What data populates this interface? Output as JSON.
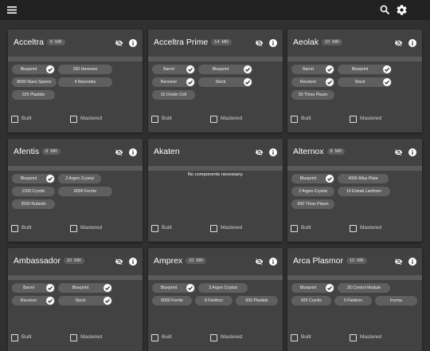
{
  "header": {
    "menu_icon": "hamburger-menu-icon",
    "search_icon": "search-icon",
    "settings_icon": "gear-icon"
  },
  "labels": {
    "built": "Built",
    "mastered": "Mastered"
  },
  "colors": {
    "background": "#303030",
    "card": "#424242",
    "topbar": "#212121",
    "chip": "#5f5f5f"
  },
  "cards": [
    {
      "name": "Acceltra",
      "mr": "6",
      "mr_label": "MR",
      "rows": [
        [
          {
            "label": "Blueprint",
            "done": true
          },
          {
            "label": "250 Hexenon",
            "done": false
          }
        ],
        [
          {
            "label": "8000 Nano Spores",
            "done": false
          },
          {
            "label": "4 Neurodes",
            "done": false
          }
        ],
        [
          {
            "label": "925 Plastids",
            "done": false
          }
        ]
      ]
    },
    {
      "name": "Acceltra Prime",
      "mr": "14",
      "mr_label": "MR",
      "rows": [
        [
          {
            "label": "Barrel",
            "done": true
          },
          {
            "label": "Blueprint",
            "done": true
          }
        ],
        [
          {
            "label": "Receiver",
            "done": true
          },
          {
            "label": "Stock",
            "done": true
          }
        ],
        [
          {
            "label": "10 Orokin Cell",
            "done": false
          }
        ]
      ]
    },
    {
      "name": "Aeolak",
      "mr": "10",
      "mr_label": "MR",
      "rows": [
        [
          {
            "label": "Barrel",
            "done": true
          },
          {
            "label": "Blueprint",
            "done": true
          }
        ],
        [
          {
            "label": "Receiver",
            "done": true
          },
          {
            "label": "Stock",
            "done": true
          }
        ],
        [
          {
            "label": "50 Thrax Plasm",
            "done": false
          }
        ]
      ]
    },
    {
      "name": "Afentis",
      "mr": "8",
      "mr_label": "MR",
      "rows": [
        [
          {
            "label": "Blueprint",
            "done": true
          },
          {
            "label": "2 Argon Crystal",
            "done": false
          }
        ],
        [
          {
            "label": "1200 Cryotic",
            "done": false
          },
          {
            "label": "8000 Ferrite",
            "done": false
          }
        ],
        [
          {
            "label": "3500 Rubedo",
            "done": false
          }
        ]
      ]
    },
    {
      "name": "Akaten",
      "mr": "",
      "mr_label": "",
      "empty_text": "No components necessary.",
      "rows": []
    },
    {
      "name": "Alternox",
      "mr": "8",
      "mr_label": "MR",
      "rows": [
        [
          {
            "label": "Blueprint",
            "done": true
          },
          {
            "label": "4000 Alloy Plate",
            "done": false
          }
        ],
        [
          {
            "label": "2 Argon Crystal",
            "done": false
          },
          {
            "label": "16 Entrati Lanthorn",
            "done": false
          }
        ],
        [
          {
            "label": "500 Thrax Plasm",
            "done": false
          }
        ]
      ]
    },
    {
      "name": "Ambassador",
      "mr": "10",
      "mr_label": "MR",
      "rows": [
        [
          {
            "label": "Barrel",
            "done": true
          },
          {
            "label": "Blueprint",
            "done": true
          }
        ],
        [
          {
            "label": "Receiver",
            "done": true
          },
          {
            "label": "Stock",
            "done": true
          }
        ]
      ]
    },
    {
      "name": "Amprex",
      "mr": "10",
      "mr_label": "MR",
      "rows": [
        [
          {
            "label": "Blueprint",
            "done": true
          },
          {
            "label": "3 Argon Crystal",
            "done": false
          }
        ],
        [
          {
            "label": "9000 Ferrite",
            "done": false
          },
          {
            "label": "8 Fieldron",
            "done": false
          },
          {
            "label": "600 Plastids",
            "done": false
          }
        ]
      ]
    },
    {
      "name": "Arca Plasmor",
      "mr": "10",
      "mr_label": "MR",
      "rows": [
        [
          {
            "label": "Blueprint",
            "done": true
          },
          {
            "label": "25 Control Module",
            "done": false
          }
        ],
        [
          {
            "label": "925 Cryotic",
            "done": false
          },
          {
            "label": "5 Fieldron",
            "done": false
          },
          {
            "label": "Forma",
            "done": false
          }
        ]
      ]
    }
  ]
}
